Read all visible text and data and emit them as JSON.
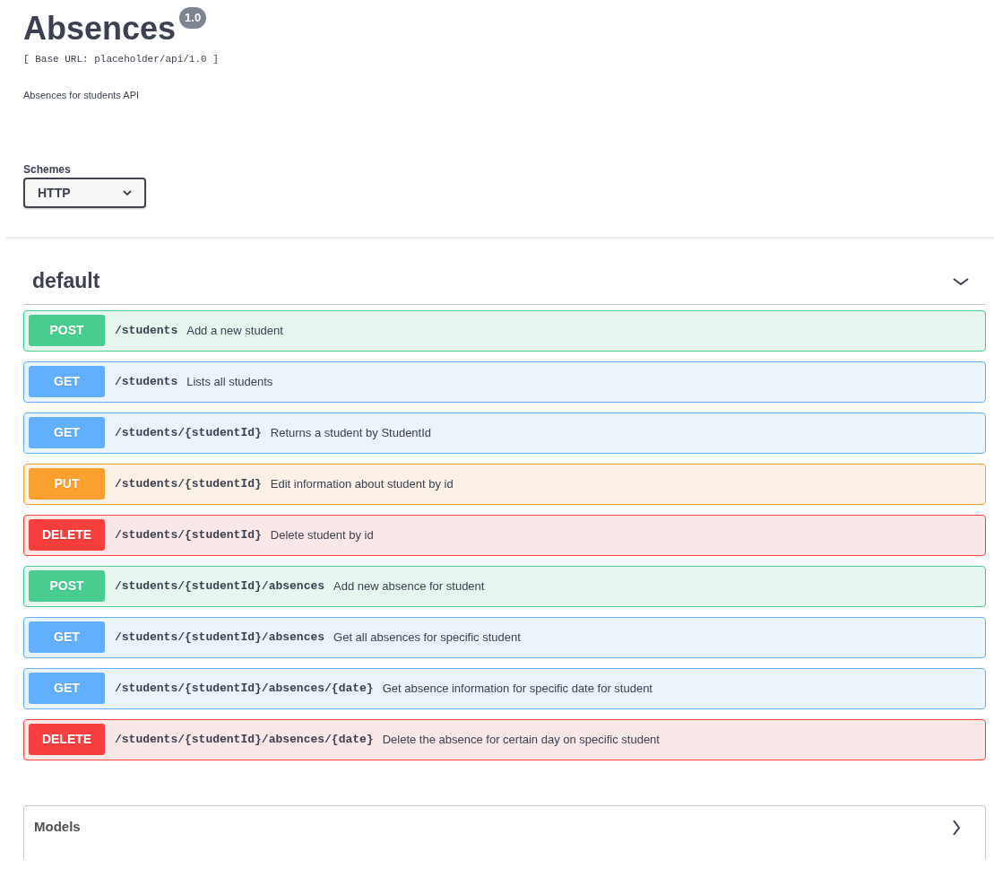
{
  "info": {
    "title": "Absences",
    "version": "1.0",
    "base_url": "[ Base URL: placeholder/api/1.0 ]",
    "description": "Absences for students API"
  },
  "schemes": {
    "label": "Schemes",
    "value": "HTTP"
  },
  "tag": {
    "name": "default",
    "expanded": true
  },
  "operations": [
    {
      "kind": "post",
      "method": "POST",
      "path": "/students",
      "summary": "Add a new student"
    },
    {
      "kind": "get",
      "method": "GET",
      "path": "/students",
      "summary": "Lists all students"
    },
    {
      "kind": "get",
      "method": "GET",
      "path": "/students/{studentId}",
      "summary": "Returns a student by StudentId"
    },
    {
      "kind": "put",
      "method": "PUT",
      "path": "/students/{studentId}",
      "summary": "Edit information about student by id"
    },
    {
      "kind": "delete",
      "method": "DELETE",
      "path": "/students/{studentId}",
      "summary": "Delete student by id"
    },
    {
      "kind": "post",
      "method": "POST",
      "path": "/students/{studentId}/absences",
      "summary": "Add new absence for student"
    },
    {
      "kind": "get",
      "method": "GET",
      "path": "/students/{studentId}/absences",
      "summary": "Get all absences for specific student"
    },
    {
      "kind": "get",
      "method": "GET",
      "path": "/students/{studentId}/absences/{date}",
      "summary": "Get absence information for specific date for student"
    },
    {
      "kind": "delete",
      "method": "DELETE",
      "path": "/students/{studentId}/absences/{date}",
      "summary": "Delete the absence for certain day on specific student"
    }
  ],
  "models": {
    "title": "Models",
    "expanded": false
  }
}
